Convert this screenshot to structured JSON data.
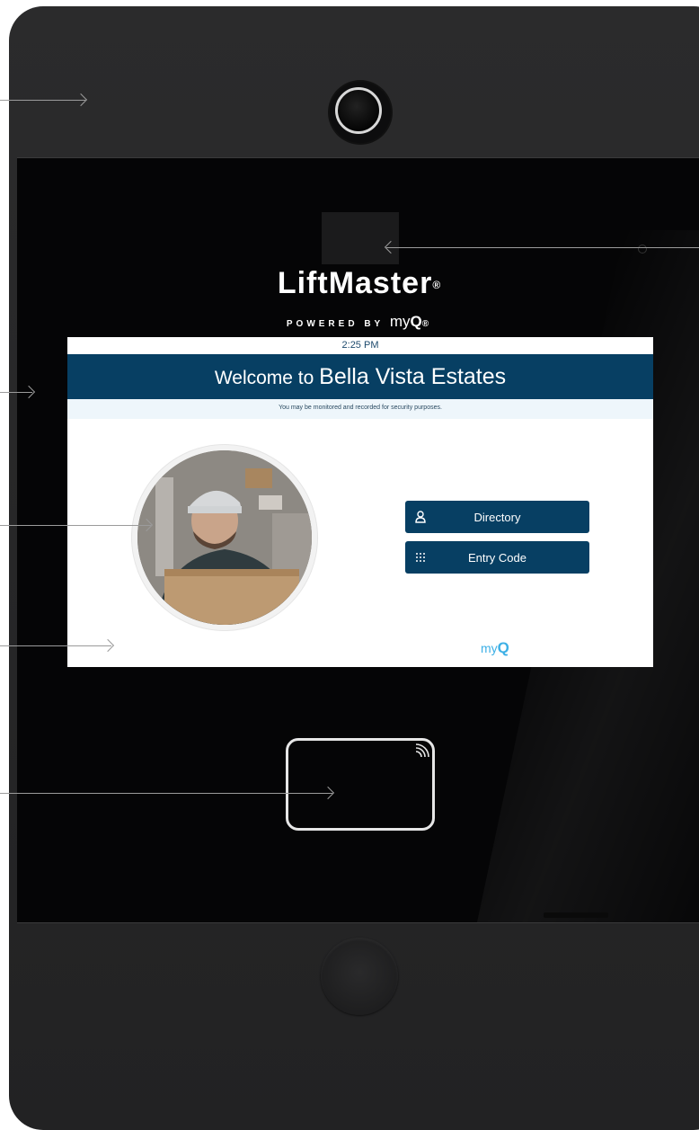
{
  "device": {
    "brand": "LiftMaster",
    "brand_reg": "®",
    "powered_by": "POWERED BY",
    "powered_myq": "my",
    "powered_myq_q": "Q",
    "powered_reg": "®"
  },
  "screen": {
    "time": "2:25 PM",
    "welcome_prefix": "Welcome to",
    "community_name": "Bella Vista Estates",
    "notice": "You may be monitored and recorded for security purposes.",
    "buttons": [
      {
        "label": "Directory",
        "icon": "person-icon"
      },
      {
        "label": "Entry Code",
        "icon": "keypad-icon"
      }
    ],
    "footer_logo_my": "my",
    "footer_logo_q": "Q"
  },
  "colors": {
    "banner": "#073f63",
    "button": "#073f63",
    "myq_accent": "#3db0e6",
    "device_body": "#2b2b2c"
  }
}
